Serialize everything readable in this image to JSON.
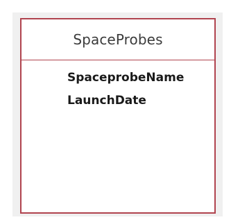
{
  "table": {
    "name": "SpaceProbes",
    "fields": [
      {
        "label": "SpaceprobeName"
      },
      {
        "label": "LaunchDate"
      }
    ]
  },
  "colors": {
    "border": "#b0434e",
    "backdrop": "#f0f0f0"
  }
}
